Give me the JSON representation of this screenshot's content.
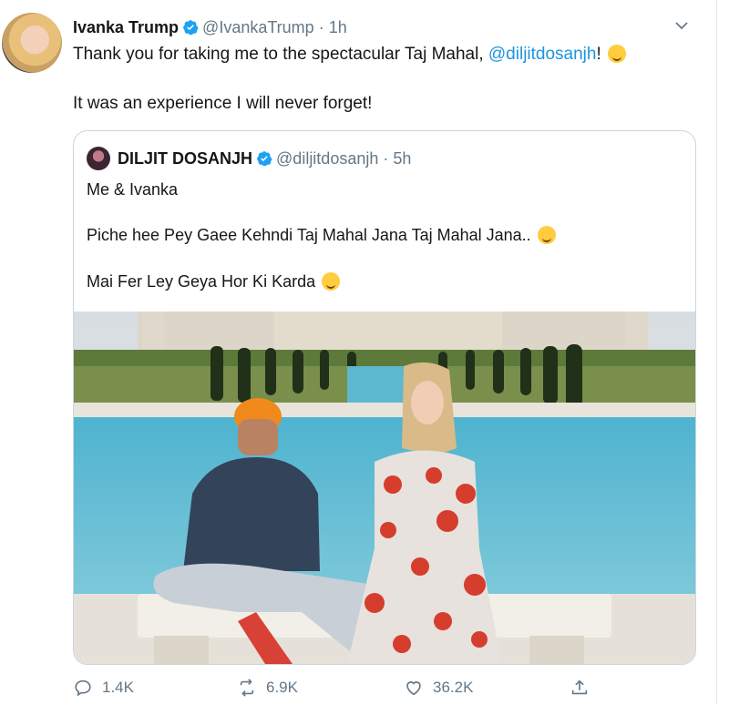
{
  "tweet": {
    "author_name": "Ivanka Trump",
    "handle": "@IvankaTrump",
    "separator": "·",
    "time": "1h",
    "line1_text": "Thank you for taking me to the spectacular Taj Mahal, ",
    "line1_mention": "@diljitdosanjh",
    "line1_end": "!",
    "line2_text": "It was an experience I will never forget!"
  },
  "quoted": {
    "author_name": "DILJIT DOSANJH",
    "handle": "@diljitdosanjh",
    "separator": "·",
    "time": "5h",
    "line1": "Me & Ivanka",
    "line2": "Piche hee Pey Gaee Kehndi Taj Mahal Jana Taj Mahal Jana..",
    "line3": "Mai Fer Ley Geya Hor Ki Karda"
  },
  "actions": {
    "reply_count": "1.4K",
    "retweet_count": "6.9K",
    "like_count": "36.2K"
  },
  "icons": {
    "verified": "verified-badge-icon",
    "caret": "chevron-down-icon",
    "reply": "reply-icon",
    "retweet": "retweet-icon",
    "like": "heart-icon",
    "share": "share-icon"
  },
  "colors": {
    "link": "#1b95e0",
    "muted": "#657786",
    "verified": "#1da1f2"
  }
}
